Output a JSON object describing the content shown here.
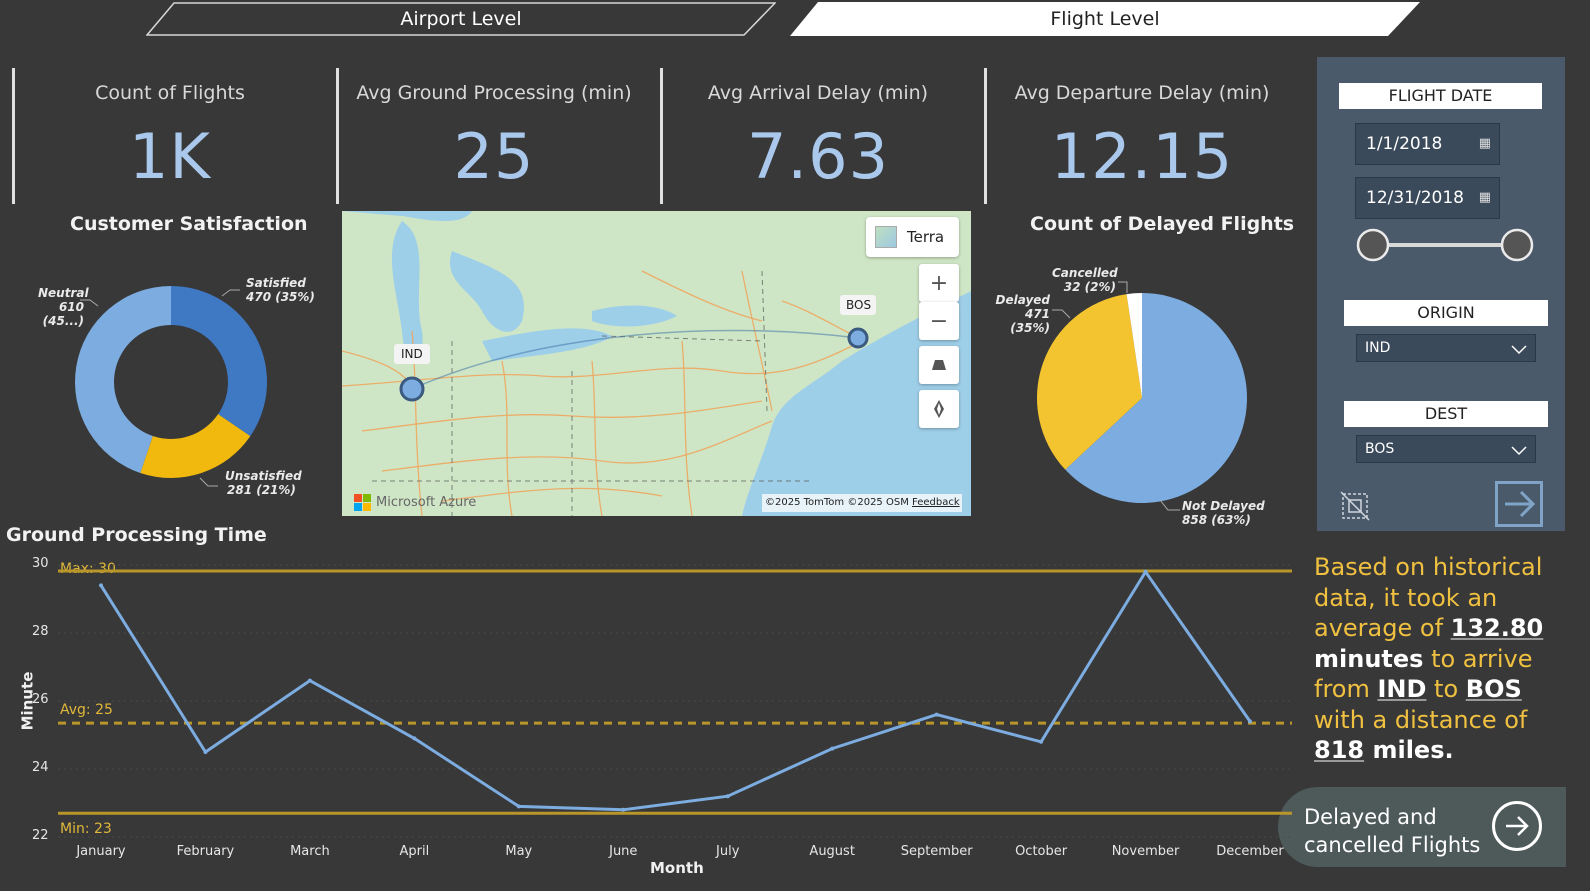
{
  "tabs": {
    "airport": "Airport Level",
    "flight": "Flight Level"
  },
  "kpis": [
    {
      "label": "Count of Flights",
      "value": "1K"
    },
    {
      "label": "Avg Ground Processing (min)",
      "value": "25"
    },
    {
      "label": "Avg Arrival Delay (min)",
      "value": "7.63"
    },
    {
      "label": "Avg Departure Delay (min)",
      "value": "12.15"
    }
  ],
  "satisfaction": {
    "title": "Customer Satisfaction",
    "neutral": {
      "name": "Neutral",
      "value": "610 (45...)"
    },
    "satisfied": {
      "name": "Satisfied",
      "value": "470 (35%)"
    },
    "unsatisfied": {
      "name": "Unsatisfied",
      "value": "281 (21%)"
    },
    "colors": {
      "neutral": "#7cace0",
      "satisfied": "#3f79c4",
      "unsatisfied": "#f1b80e"
    }
  },
  "map": {
    "style_button": "Terra",
    "origin_code": "IND",
    "dest_code": "BOS",
    "attribution": "©2025 TomTom  ©2025 OSM",
    "feedback": "Feedback",
    "brand": "Microsoft Azure",
    "controls": {
      "zoom_in": "+",
      "zoom_out": "−"
    }
  },
  "delayed": {
    "title": "Count of Delayed Flights",
    "cancelled": {
      "name": "Cancelled",
      "value": "32 (2%)"
    },
    "delayed": {
      "name": "Delayed",
      "value": "471 (35%)"
    },
    "not_delayed": {
      "name": "Not Delayed",
      "value": "858 (63%)"
    },
    "colors": {
      "not_delayed": "#7cace0",
      "delayed": "#f4c430",
      "cancelled": "#ffffff"
    }
  },
  "filters": {
    "flight_date_label": "FLIGHT DATE",
    "date_from": "1/1/2018",
    "date_to": "12/31/2018",
    "origin_label": "ORIGIN",
    "origin_value": "IND",
    "dest_label": "DEST",
    "dest_value": "BOS"
  },
  "narrative": {
    "p1": "Based on historical data, it took an average of ",
    "minutes": "132.80",
    "p2": "minutes",
    "p3": " to arrive from ",
    "origin": "IND",
    "p4": " to ",
    "dest": "BOS",
    "p5": " with a distance of ",
    "miles": "818",
    "p6": " miles."
  },
  "delayed_button": {
    "line1": "Delayed and",
    "line2": "cancelled Flights"
  },
  "chart_data": {
    "type": "line",
    "title": "Ground Processing Time",
    "xlabel": "Month",
    "ylabel": "Minute",
    "categories": [
      "January",
      "February",
      "March",
      "April",
      "May",
      "June",
      "July",
      "August",
      "September",
      "October",
      "November",
      "December"
    ],
    "values": [
      29.4,
      24.5,
      26.6,
      24.9,
      22.9,
      22.8,
      23.2,
      24.6,
      25.6,
      24.8,
      29.8,
      25.4
    ],
    "ylim": [
      22,
      30
    ],
    "yticks": [
      "30",
      "28",
      "26",
      "24",
      "22"
    ],
    "reference_lines": {
      "max": "Max: 30",
      "avg": "Avg: 25",
      "min": "Min: 23"
    },
    "colors": {
      "line": "#7cace0",
      "ref": "#b8962a"
    }
  }
}
